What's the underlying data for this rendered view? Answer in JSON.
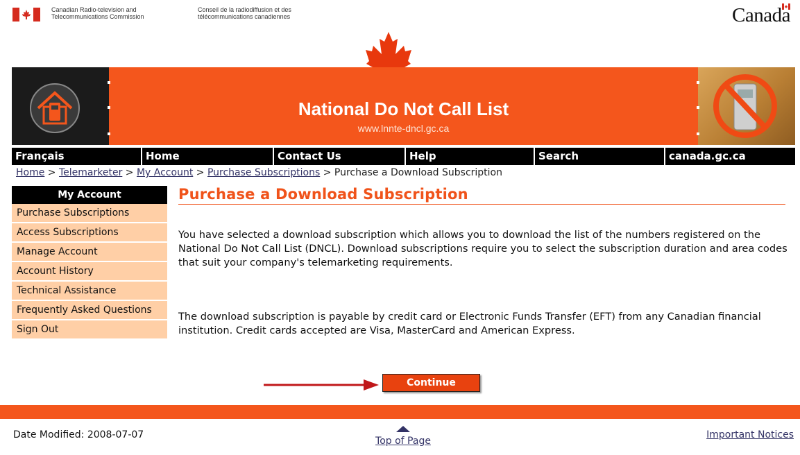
{
  "fip": {
    "dept_en_line1": "Canadian Radio-television and",
    "dept_en_line2": "Telecommunications Commission",
    "dept_fr_line1": "Conseil de la radiodiffusion et des",
    "dept_fr_line2": "télécommunications canadiennes",
    "wordmark": "Canada"
  },
  "banner": {
    "title": "National Do Not Call List",
    "url": "www.lnnte-dncl.gc.ca"
  },
  "nav": {
    "items": [
      {
        "label": "Français"
      },
      {
        "label": "Home"
      },
      {
        "label": "Contact Us"
      },
      {
        "label": "Help"
      },
      {
        "label": "Search"
      },
      {
        "label": "canada.gc.ca"
      }
    ]
  },
  "breadcrumb": {
    "home": "Home",
    "telemarketer": "Telemarketer",
    "my_account": "My Account",
    "purchase_subscriptions": "Purchase Subscriptions",
    "current": "Purchase a Download Subscription",
    "separator": " > "
  },
  "sidebar": {
    "heading": "My Account",
    "items": [
      {
        "label": "Purchase Subscriptions"
      },
      {
        "label": "Access Subscriptions"
      },
      {
        "label": "Manage Account"
      },
      {
        "label": "Account History"
      },
      {
        "label": "Technical Assistance"
      },
      {
        "label": "Frequently Asked Questions"
      },
      {
        "label": "Sign Out"
      }
    ]
  },
  "main": {
    "title": "Purchase a Download Subscription",
    "paragraph1": "You have selected a download subscription which allows you to download the list of the numbers registered on the National Do Not Call List (DNCL). Download subscriptions require you to select the subscription duration and area codes that suit your company's telemarketing requirements.",
    "paragraph2": "The download subscription is payable by credit card or Electronic Funds Transfer (EFT) from any Canadian financial institution. Credit cards accepted are Visa, MasterCard and American Express.",
    "continue_label": "Continue"
  },
  "footer": {
    "date_modified": "Date Modified: 2008-07-07",
    "top_of_page": "Top of Page",
    "important_notices": "Important Notices"
  },
  "colors": {
    "brand_orange": "#f4561c",
    "sidebar_bg": "#ffcfa6",
    "link": "#333366",
    "heading": "#f0531a"
  }
}
